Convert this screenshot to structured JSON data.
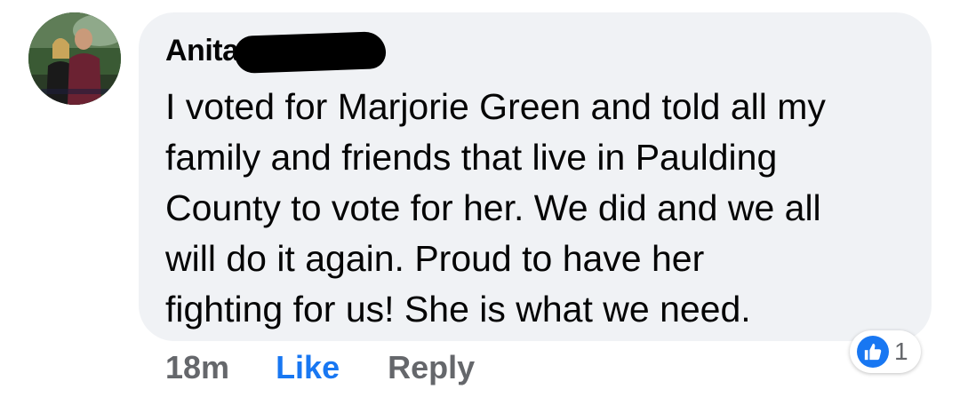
{
  "comment": {
    "author": "Anita",
    "text": "I voted for Marjorie Green and told all my\nfamily and friends that live in Paulding\nCounty to vote for her. We did and we all\nwill do it again. Proud to have her\nfighting for us! She is what we need.",
    "time": "18m",
    "like_label": "Like",
    "reply_label": "Reply",
    "reaction_count": "1",
    "reaction_icon": "thumbs-up-icon"
  },
  "colors": {
    "bubble": "#f0f2f5",
    "link_blue": "#1877f2",
    "meta_gray": "#65676b",
    "text": "#050505"
  }
}
